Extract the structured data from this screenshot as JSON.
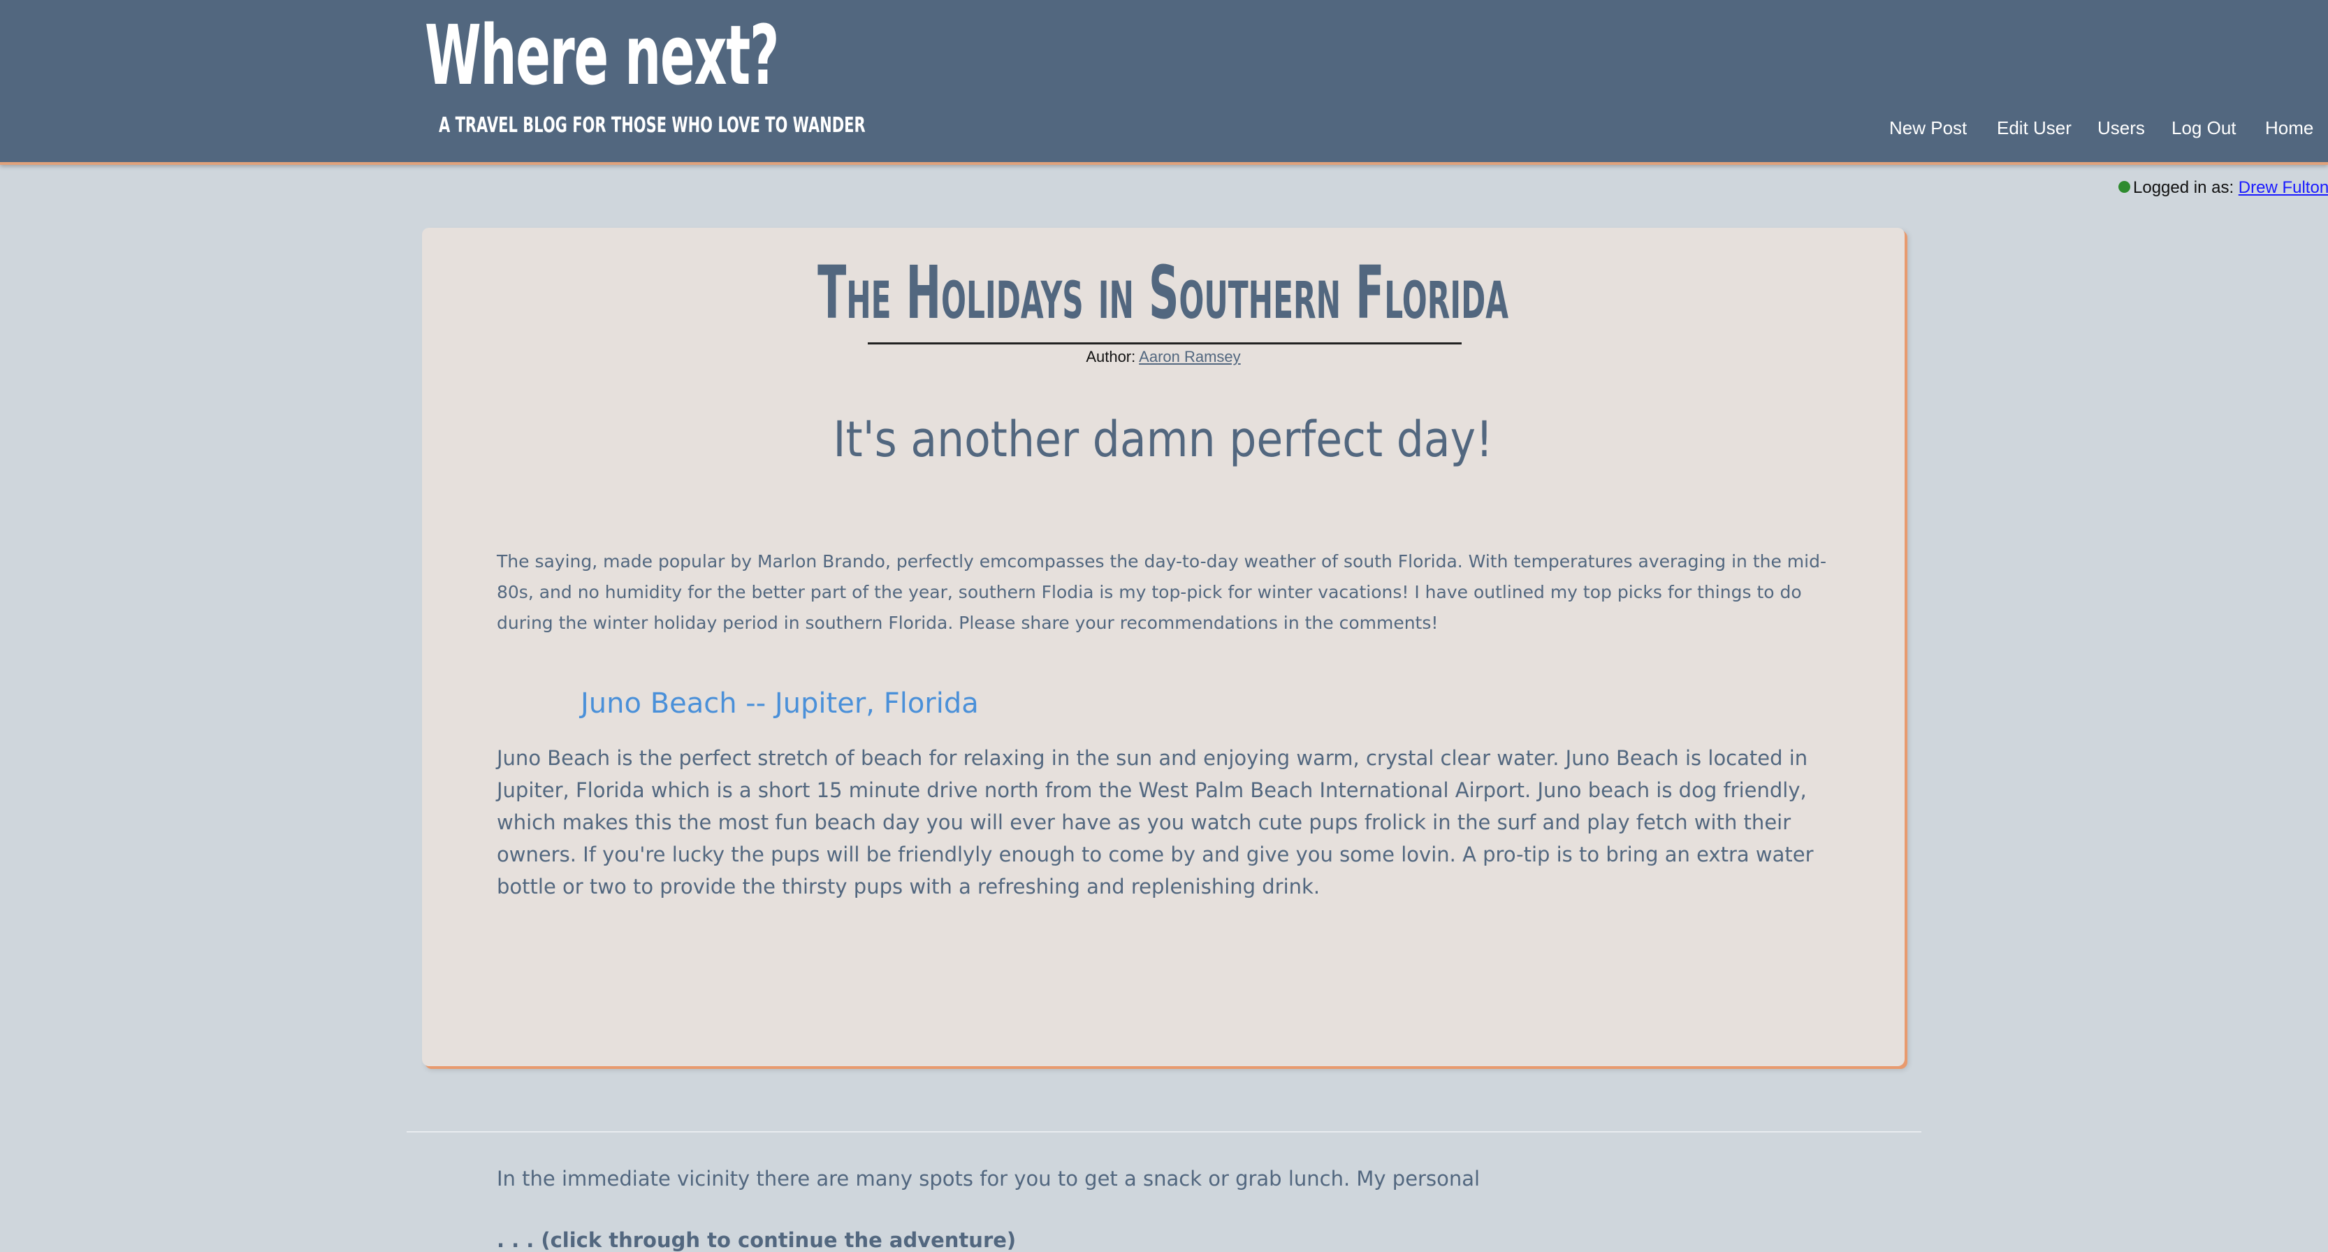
{
  "header": {
    "title": "Where next?",
    "tagline": "A travel blog for those who love to wander",
    "nav": {
      "new_post": "New Post",
      "edit_user": "Edit User",
      "users": "Users",
      "log_out": "Log Out",
      "home": "Home"
    },
    "colors": {
      "background": "#52677f",
      "accent": "#e0a27c"
    }
  },
  "session": {
    "status_label": "Logged in as:",
    "user_name": "Drew Fulton",
    "status_color": "#2e8b2e"
  },
  "post": {
    "title": "The Holidays in Southern Florida",
    "byline_label": "Author:",
    "author": "Aaron Ramsey",
    "subtitle": "It's another damn perfect day!",
    "intro": "The saying, made popular by Marlon Brando, perfectly emcompasses the day-to-day weather of south Florida. With temperatures averaging in the mid-80s, and no humidity for the better part of the year, southern Flodia is my top-pick for winter vacations! I have outlined my top picks for things to do during the winter holiday period in southern Florida. Please share your recommendations in the comments!",
    "section_heading": "Juno Beach -- Jupiter, Florida",
    "paragraph_1": "Juno Beach is the perfect stretch of beach for relaxing in the sun and enjoying warm, crystal clear water. Juno Beach is located in Jupiter, Florida which is a short 15 minute drive north from the West Palm Beach International Airport. Juno beach is dog friendly, which makes this the most fun beach day you will ever have as you watch cute pups frolick in the surf and play fetch with their owners. If you're lucky the pups will be friendlyly enough to come by and give you some lovin. A pro-tip is to bring an extra water bottle or two to provide the thirsty pups with a refreshing and replenishing drink.",
    "paragraph_2": "In the immediate vicinity there are many spots for you to get a snack or grab lunch. My personal",
    "continue_label": ". . . (click through to continue the adventure)",
    "colors": {
      "card_background": "#e6e0dc",
      "text": "#52677f",
      "heading": "#4a90d9",
      "shadow_accent": "#e89a6e"
    }
  }
}
